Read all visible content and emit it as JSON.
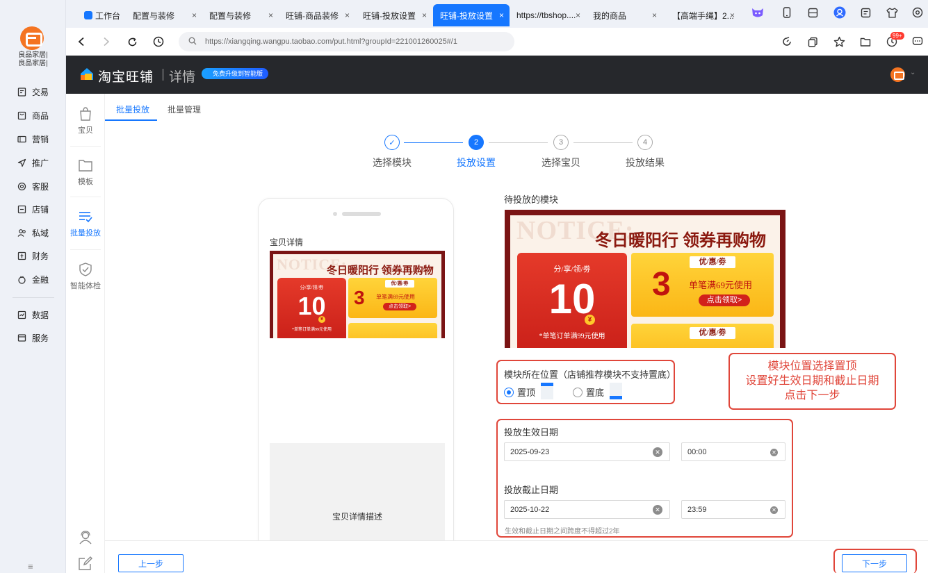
{
  "app": {
    "shop_name_line1": "良品家居|",
    "shop_name_line2": "良品家居|",
    "sidebar": [
      "交易",
      "商品",
      "营销",
      "推广",
      "客服",
      "店铺",
      "私域",
      "财务",
      "金融",
      "数据",
      "服务"
    ],
    "collapse_label": "≡"
  },
  "browser": {
    "tabs": [
      {
        "label": "工作台",
        "active": false
      },
      {
        "label": "配置与装修",
        "active": false
      },
      {
        "label": "配置与装修",
        "active": false
      },
      {
        "label": "旺铺-商品装修",
        "active": false
      },
      {
        "label": "旺铺-投放设置",
        "active": false
      },
      {
        "label": "旺铺-投放设置",
        "active": true
      },
      {
        "label": "https://tbshop....",
        "active": false
      },
      {
        "label": "我的商品",
        "active": false
      },
      {
        "label": "【高端手绳】2...",
        "active": false
      }
    ],
    "close_glyph": "×",
    "url": "https://xiangqing.wangpu.taobao.com/put.html?groupId=221001260025#/1",
    "notification_badge": "99+"
  },
  "header": {
    "brand": "淘宝旺铺",
    "sub": "详情",
    "upgrade": "免费升级到智能版"
  },
  "subnav": [
    "宝贝",
    "模板",
    "批量投放",
    "智能体检"
  ],
  "main": {
    "tabs": [
      "批量投放",
      "批量管理"
    ],
    "steps": [
      {
        "num": "✓",
        "label": "选择模块"
      },
      {
        "num": "2",
        "label": "投放设置"
      },
      {
        "num": "3",
        "label": "选择宝贝"
      },
      {
        "num": "4",
        "label": "投放结果"
      }
    ],
    "phone": {
      "title": "宝贝详情",
      "desc": "宝贝详情描述"
    },
    "banner": {
      "notice": "NOTICE:",
      "headline": "冬日暖阳行 领券再购物",
      "red_title": "分/享/领/劵",
      "red_value": "10",
      "red_cond": "*单笔订单满99元使用",
      "gold_chip": "优/惠/劵",
      "gold_value": "3",
      "gold_cond": "单笔满69元使用",
      "gold_btn": "点击领取>",
      "gold_chip2": "优/惠/劵",
      "coin": "¥"
    },
    "pending_title": "待投放的模块",
    "position": {
      "label": "模块所在位置（店铺推荐模块不支持置底）",
      "top": "置顶",
      "bottom": "置底"
    },
    "note": {
      "line1": "模块位置选择置顶",
      "line2": "设置好生效日期和截止日期",
      "line3": "点击下一步"
    },
    "dates": {
      "start_label": "投放生效日期",
      "start_date": "2025-09-23",
      "start_time": "00:00",
      "end_label": "投放截止日期",
      "end_date": "2025-10-22",
      "end_time": "23:59",
      "hint": "生效和截止日期之间跨度不得超过2年"
    },
    "footer": {
      "prev": "上一步",
      "next": "下一步"
    }
  }
}
